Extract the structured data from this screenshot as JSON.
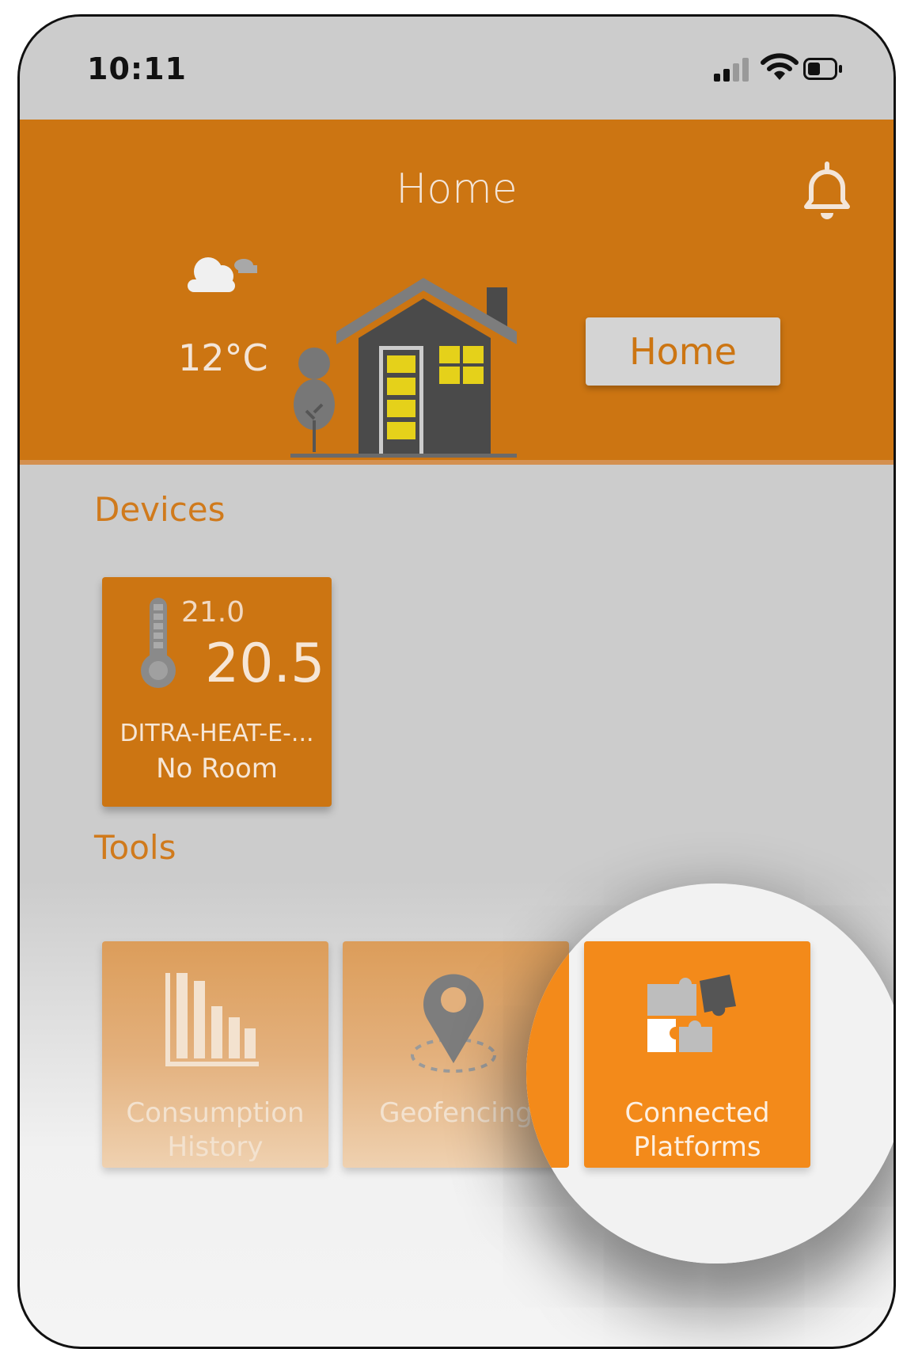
{
  "status_bar": {
    "time": "10:11"
  },
  "header": {
    "title": "Home",
    "weather_temp": "12°C",
    "mode_button": "Home"
  },
  "devices": {
    "section_title": "Devices",
    "items": [
      {
        "set_temp": "21.0",
        "current_temp": "20.5",
        "name": "DITRA-HEAT-E-...",
        "room": "No Room"
      }
    ]
  },
  "tools": {
    "section_title": "Tools",
    "items": [
      {
        "label_line1": "Consumption",
        "label_line2": "History",
        "icon": "bar-chart-icon"
      },
      {
        "label_line1": "Geofencing",
        "label_line2": "",
        "icon": "location-pin-icon"
      },
      {
        "label_line1": "Connected",
        "label_line2": "Platforms",
        "icon": "puzzle-icon"
      }
    ]
  },
  "colors": {
    "brand": "#cc7512",
    "highlight": "#f38a1a",
    "background": "#cccccc"
  }
}
